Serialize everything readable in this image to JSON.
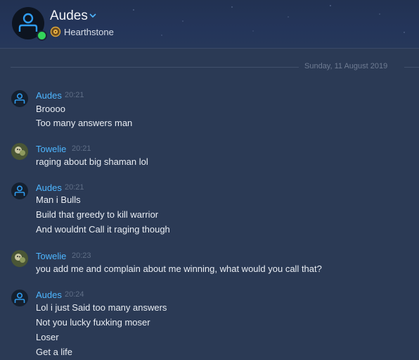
{
  "header": {
    "contact_name": "Audes",
    "game": "Hearthstone",
    "status_color": "#33d45a"
  },
  "date_separator": "Sunday, 11 August 2019",
  "messages": [
    {
      "sender": "Audes",
      "time": "20:21",
      "lines": [
        "Broooo",
        "Too many answers man"
      ]
    },
    {
      "sender": "Towelie",
      "time": "20:21",
      "lines": [
        "raging about big shaman lol"
      ]
    },
    {
      "sender": "Audes",
      "time": "20:21",
      "lines": [
        "Man i Bulls",
        "Build that greedy to kill warrior",
        "And wouldnt Call it raging though"
      ]
    },
    {
      "sender": "Towelie",
      "time": "20:23",
      "lines": [
        "you add me and complain about me winning, what would you call that?"
      ]
    },
    {
      "sender": "Audes",
      "time": "20:24",
      "lines": [
        "Lol i just Said too many answers",
        "Not you lucky fuxking moser",
        "Loser",
        "Get a life"
      ]
    }
  ]
}
